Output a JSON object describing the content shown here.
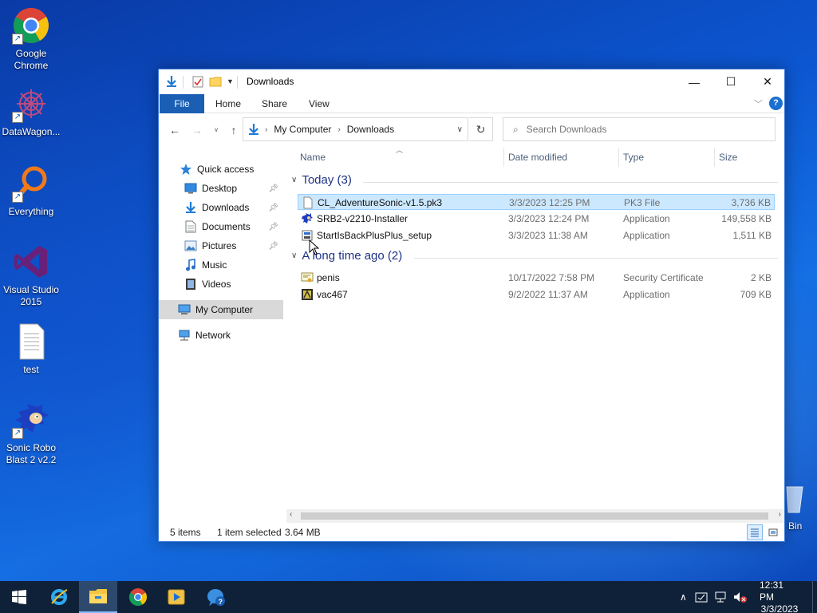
{
  "desktop": {
    "icons": [
      {
        "label_line1": "Google",
        "label_line2": "Chrome",
        "icon": "chrome-icon"
      },
      {
        "label_line1": "DataWagon...",
        "label_line2": "",
        "icon": "datawagon-icon"
      },
      {
        "label_line1": "Everything",
        "label_line2": "",
        "icon": "everything-search-icon"
      },
      {
        "label_line1": "Visual Studio",
        "label_line2": "2015",
        "icon": "visual-studio-icon"
      },
      {
        "label_line1": "test",
        "label_line2": "",
        "icon": "text-document-icon"
      },
      {
        "label_line1": "Sonic Robo",
        "label_line2": "Blast 2 v2.2",
        "icon": "sonic-icon"
      }
    ],
    "recycle_bin_partial_label": "Bin"
  },
  "window": {
    "title": "Downloads",
    "controls": {
      "minimize": "—",
      "maximize": "☐",
      "close": "✕"
    },
    "ribbon_tabs": [
      "File",
      "Home",
      "Share",
      "View"
    ],
    "address": {
      "crumbs": [
        "My Computer",
        "Downloads"
      ]
    },
    "search": {
      "placeholder": "Search Downloads"
    },
    "nav": {
      "quick_access": "Quick access",
      "items": [
        {
          "label": "Desktop",
          "icon": "desktop-folder-icon",
          "pinned": true
        },
        {
          "label": "Downloads",
          "icon": "downloads-folder-icon",
          "pinned": true
        },
        {
          "label": "Documents",
          "icon": "documents-folder-icon",
          "pinned": true
        },
        {
          "label": "Pictures",
          "icon": "pictures-folder-icon",
          "pinned": true
        },
        {
          "label": "Music",
          "icon": "music-folder-icon",
          "pinned": false
        },
        {
          "label": "Videos",
          "icon": "videos-folder-icon",
          "pinned": false
        }
      ],
      "my_computer": "My Computer",
      "network": "Network"
    },
    "columns": {
      "name": "Name",
      "date": "Date modified",
      "type": "Type",
      "size": "Size"
    },
    "groups": [
      {
        "title": "Today (3)",
        "files": [
          {
            "name": "CL_AdventureSonic-v1.5.pk3",
            "date": "3/3/2023 12:25 PM",
            "type": "PK3 File",
            "size": "3,736 KB",
            "selected": true,
            "icon": "blank-file-icon"
          },
          {
            "name": "SRB2-v2210-Installer",
            "date": "3/3/2023 12:24 PM",
            "type": "Application",
            "size": "149,558 KB",
            "selected": false,
            "icon": "srb2-installer-icon"
          },
          {
            "name": "StartIsBackPlusPlus_setup",
            "date": "3/3/2023 11:38 AM",
            "type": "Application",
            "size": "1,511 KB",
            "selected": false,
            "icon": "setup-app-icon"
          }
        ]
      },
      {
        "title": "A long time ago (2)",
        "files": [
          {
            "name": "penis",
            "date": "10/17/2022 7:58 PM",
            "type": "Security Certificate",
            "size": "2 KB",
            "selected": false,
            "icon": "certificate-icon"
          },
          {
            "name": "vac467",
            "date": "9/2/2022 11:37 AM",
            "type": "Application",
            "size": "709 KB",
            "selected": false,
            "icon": "application-icon"
          }
        ]
      }
    ],
    "status": {
      "items": "5 items",
      "selected": "1 item selected",
      "size": "3.64 MB"
    }
  },
  "taskbar": {
    "apps": [
      "windows-start-icon",
      "internet-explorer-icon",
      "file-explorer-icon",
      "chrome-icon",
      "media-player-icon",
      "help-icon"
    ],
    "clock": {
      "time": "12:31 PM",
      "date": "3/3/2023"
    }
  },
  "colors": {
    "accent": "#1a5fb4",
    "selection": "#cce8ff",
    "group_header": "#1e3287",
    "taskbar": "#0f2138"
  }
}
